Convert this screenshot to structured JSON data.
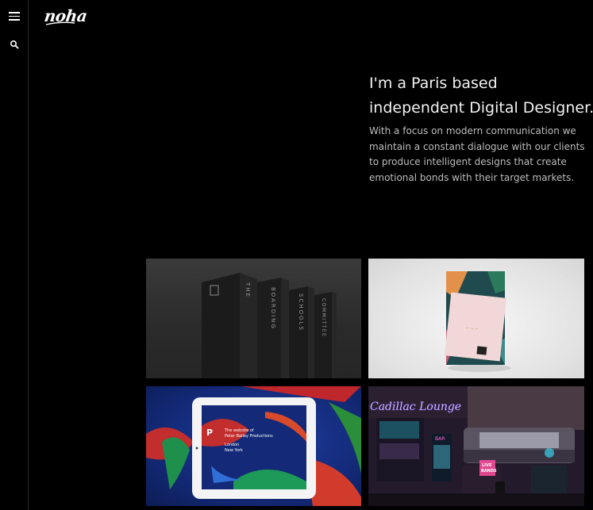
{
  "brand": {
    "logo_text": "noha"
  },
  "sidebar": {
    "menu_icon": "hamburger-icon",
    "search_icon": "search-icon"
  },
  "hero": {
    "headline_line1": "I'm a Paris based",
    "headline_line2": "independent Digital Designer.",
    "intro": "With a focus on modern communication we maintain a constant dialogue with our clients to produce intelligent designs that create emotional bonds with their target markets."
  },
  "portfolio": {
    "tiles": [
      {
        "name": "boarding-schools-signage",
        "words": [
          "THE",
          "BOARDING",
          "SCHOOLS",
          "COMMITTEE"
        ]
      },
      {
        "name": "floral-card-packaging"
      },
      {
        "name": "peter-bailey-website",
        "tablet_letter": "P",
        "tablet_line1": "The website of",
        "tablet_line2": "Peter Bailey Productions",
        "tablet_line3": "London",
        "tablet_line4": "New York"
      },
      {
        "name": "cadillac-lounge",
        "sign_text": "Cadillac Lounge",
        "bar_sign": "BAR",
        "live_bands": "LIVE",
        "live_bands2": "BANDS"
      }
    ]
  },
  "colors": {
    "background": "#000000",
    "text": "#f2f2f2",
    "muted": "#bdbdbd",
    "divider": "#2a2a2a"
  }
}
